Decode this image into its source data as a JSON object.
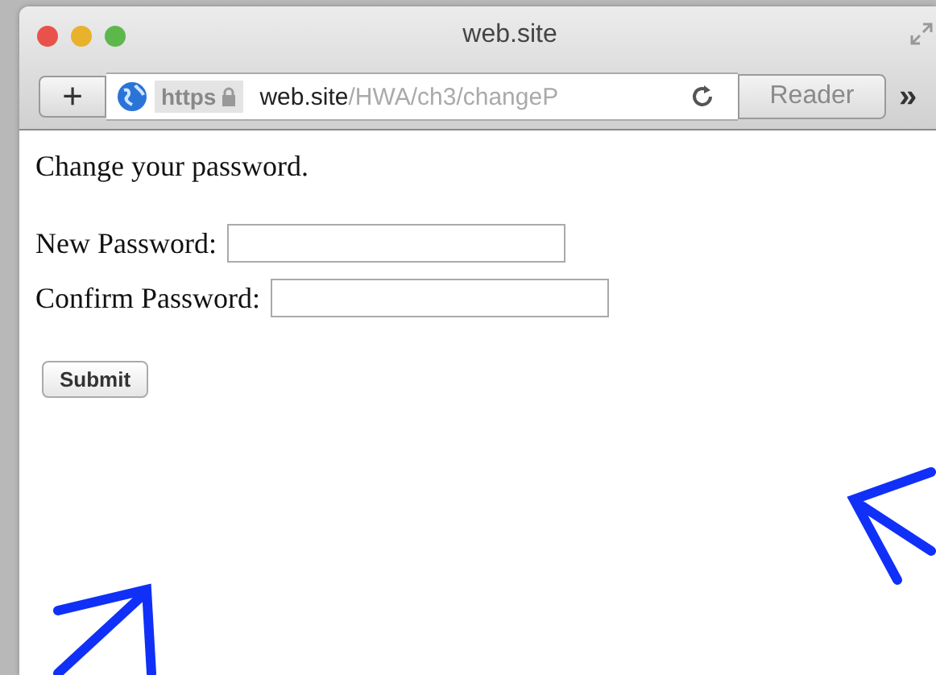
{
  "window": {
    "title": "web.site"
  },
  "toolbar": {
    "new_tab": "+",
    "address": {
      "scheme": "https",
      "host": "web.site",
      "path": "/HWA/ch3/changeP"
    },
    "reader": "Reader",
    "overflow": "»"
  },
  "page": {
    "heading": "Change your password.",
    "fields": [
      {
        "label": "New Password:"
      },
      {
        "label": "Confirm Password:"
      }
    ],
    "submit": "Submit"
  }
}
